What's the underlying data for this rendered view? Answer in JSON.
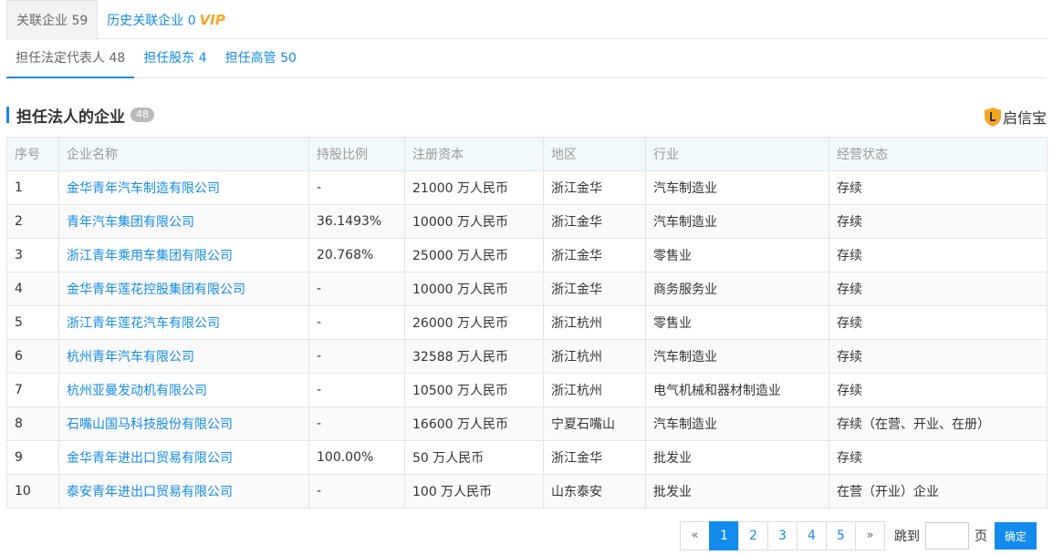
{
  "top_tabs": [
    {
      "label": "关联企业 59"
    },
    {
      "label": "历史关联企业 0",
      "badge": "VIP"
    }
  ],
  "sub_tabs": [
    {
      "label": "担任法定代表人 48"
    },
    {
      "label": "担任股东 4"
    },
    {
      "label": "担任高管 50"
    }
  ],
  "section": {
    "title": "担任法人的企业",
    "count": "48"
  },
  "brand": {
    "name": "启信宝",
    "icon": "shield-icon",
    "color": "#f5a623"
  },
  "table": {
    "headers": [
      "序号",
      "企业名称",
      "持股比例",
      "注册资本",
      "地区",
      "行业",
      "经营状态"
    ],
    "rows": [
      {
        "no": "1",
        "name": "金华青年汽车制造有限公司",
        "share": "-",
        "capital": "21000 万人民币",
        "region": "浙江金华",
        "industry": "汽车制造业",
        "status": "存续"
      },
      {
        "no": "2",
        "name": "青年汽车集团有限公司",
        "share": "36.1493%",
        "capital": "10000 万人民币",
        "region": "浙江金华",
        "industry": "汽车制造业",
        "status": "存续"
      },
      {
        "no": "3",
        "name": "浙江青年乘用车集团有限公司",
        "share": "20.768%",
        "capital": "25000 万人民币",
        "region": "浙江金华",
        "industry": "零售业",
        "status": "存续"
      },
      {
        "no": "4",
        "name": "金华青年莲花控股集团有限公司",
        "share": "-",
        "capital": "10000 万人民币",
        "region": "浙江金华",
        "industry": "商务服务业",
        "status": "存续"
      },
      {
        "no": "5",
        "name": "浙江青年莲花汽车有限公司",
        "share": "-",
        "capital": "26000 万人民币",
        "region": "浙江杭州",
        "industry": "零售业",
        "status": "存续"
      },
      {
        "no": "6",
        "name": "杭州青年汽车有限公司",
        "share": "-",
        "capital": "32588 万人民币",
        "region": "浙江杭州",
        "industry": "汽车制造业",
        "status": "存续"
      },
      {
        "no": "7",
        "name": "杭州亚曼发动机有限公司",
        "share": "-",
        "capital": "10500 万人民币",
        "region": "浙江杭州",
        "industry": "电气机械和器材制造业",
        "status": "存续"
      },
      {
        "no": "8",
        "name": "石嘴山国马科技股份有限公司",
        "share": "-",
        "capital": "16600 万人民币",
        "region": "宁夏石嘴山",
        "industry": "汽车制造业",
        "status": "存续（在营、开业、在册）"
      },
      {
        "no": "9",
        "name": "金华青年进出口贸易有限公司",
        "share": "100.00%",
        "capital": "50 万人民币",
        "region": "浙江金华",
        "industry": "批发业",
        "status": "存续"
      },
      {
        "no": "10",
        "name": "泰安青年进出口贸易有限公司",
        "share": "-",
        "capital": "100 万人民币",
        "region": "山东泰安",
        "industry": "批发业",
        "status": "在营（开业）企业"
      }
    ]
  },
  "pager": {
    "prev": "«",
    "pages": [
      "1",
      "2",
      "3",
      "4",
      "5"
    ],
    "current": "1",
    "next": "»",
    "jump_label": "跳到",
    "jump_value": "",
    "unit": "页",
    "confirm": "确定"
  },
  "colors": {
    "accent": "#128bed",
    "vip": "#f5a623",
    "header_bg": "#f2f9fc"
  }
}
